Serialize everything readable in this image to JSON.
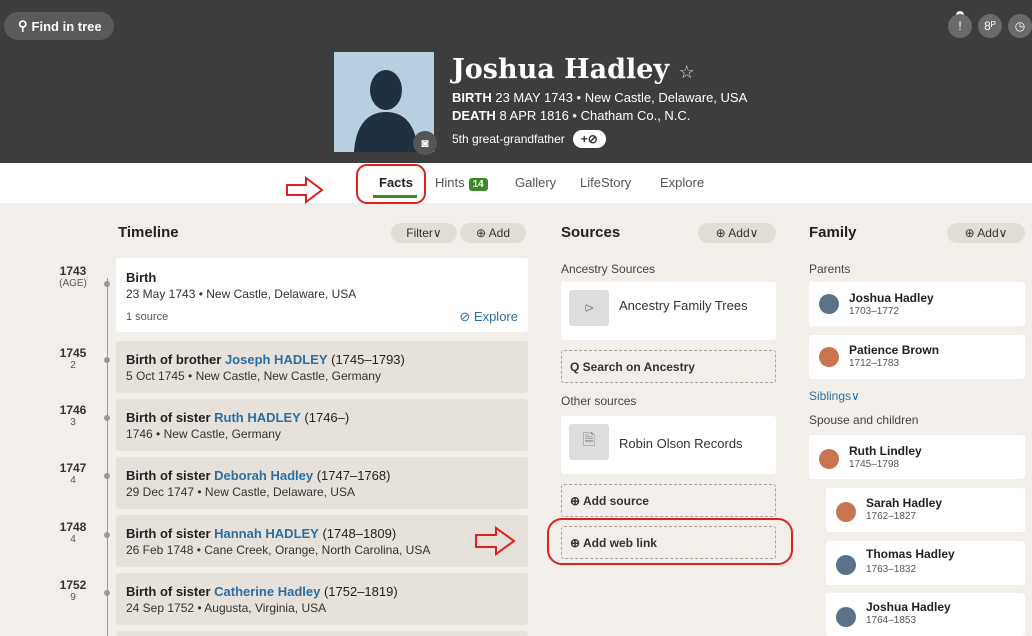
{
  "header": {
    "find_in_tree": "Find in tree",
    "icon_labels": [
      "!",
      "8ᴾ",
      "◷"
    ],
    "person": {
      "name": "Joshua Hadley",
      "birth_label": "BIRTH",
      "birth_value": "23 MAY 1743 • New Castle, Delaware, USA",
      "death_label": "DEATH",
      "death_value": "8 APR 1816 • Chatham Co., N.C.",
      "relationship": "5th great-grandfather",
      "tag_button": "+⊘"
    }
  },
  "tabs": [
    {
      "label": "Facts"
    },
    {
      "label": "Hints",
      "badge": "14"
    },
    {
      "label": "Gallery"
    },
    {
      "label": "LifeStory"
    },
    {
      "label": "Explore"
    }
  ],
  "timeline": {
    "title": "Timeline",
    "filter": "Filter∨",
    "add": "⊕ Add",
    "events": [
      {
        "year": "1743",
        "age": "(AGE)",
        "title": "Birth",
        "link": "",
        "years": "",
        "sub": "23 May 1743 • New Castle, Delaware, USA",
        "sources": "1 source",
        "explore": "⊘ Explore"
      },
      {
        "year": "1745",
        "age": "2",
        "title": "Birth of brother ",
        "link": "Joseph HADLEY",
        "years": " (1745–1793)",
        "sub": "5 Oct 1745 • New Castle, New Castle, Germany"
      },
      {
        "year": "1746",
        "age": "3",
        "title": "Birth of sister ",
        "link": "Ruth HADLEY",
        "years": " (1746–)",
        "sub": "1746 • New Castle, Germany"
      },
      {
        "year": "1747",
        "age": "4",
        "title": "Birth of sister ",
        "link": "Deborah Hadley",
        "years": " (1747–1768)",
        "sub": "29 Dec 1747 • New Castle, Delaware, USA"
      },
      {
        "year": "1748",
        "age": "4",
        "title": "Birth of sister ",
        "link": "Hannah HADLEY",
        "years": " (1748–1809)",
        "sub": "26 Feb 1748 • Cane Creek, Orange, North Carolina, USA"
      },
      {
        "year": "1752",
        "age": "9",
        "title": "Birth of sister ",
        "link": "Catherine Hadley",
        "years": " (1752–1819)",
        "sub": "24 Sep 1752 • Augusta, Virginia, USA"
      }
    ]
  },
  "sources": {
    "title": "Sources",
    "add": "⊕ Add∨",
    "ancestry_label": "Ancestry Sources",
    "ancestry_item": "Ancestry Family Trees",
    "search": "Q Search on Ancestry",
    "other_label": "Other sources",
    "other_item": "Robin Olson Records",
    "add_source": "⊕ Add source",
    "add_web_link": "⊕ Add web link"
  },
  "family": {
    "title": "Family",
    "add": "⊕ Add∨",
    "parents_label": "Parents",
    "parents": [
      {
        "name": "Joshua Hadley",
        "years": "1703–1772"
      },
      {
        "name": "Patience Brown",
        "years": "1712–1783"
      }
    ],
    "siblings": "Siblings∨",
    "spouse_label": "Spouse and children",
    "spouse": {
      "name": "Ruth Lindley",
      "years": "1745–1798"
    },
    "children": [
      {
        "name": "Sarah Hadley",
        "years": "1762–1827"
      },
      {
        "name": "Thomas Hadley",
        "years": "1763–1832"
      },
      {
        "name": "Joshua Hadley",
        "years": "1764–1853"
      }
    ]
  },
  "colors": {
    "header_bg": "#3d3d3d",
    "accent_green": "#3a8a2a",
    "link_blue": "#2a6fa3",
    "annotation_red": "#e02020"
  }
}
